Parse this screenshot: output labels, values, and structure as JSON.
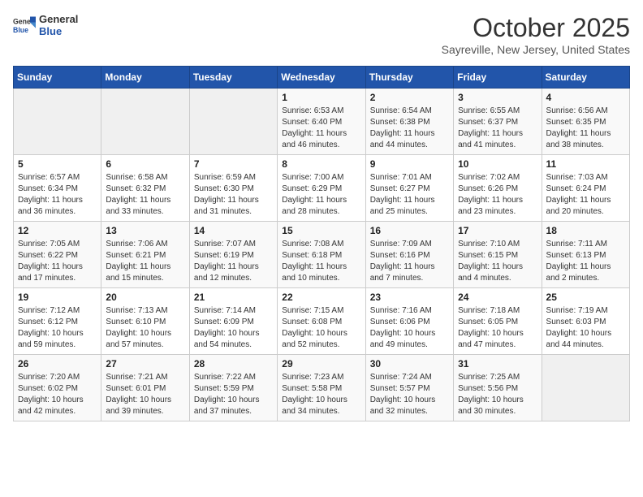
{
  "header": {
    "logo_general": "General",
    "logo_blue": "Blue",
    "title": "October 2025",
    "subtitle": "Sayreville, New Jersey, United States"
  },
  "days_of_week": [
    "Sunday",
    "Monday",
    "Tuesday",
    "Wednesday",
    "Thursday",
    "Friday",
    "Saturday"
  ],
  "weeks": [
    [
      {
        "day": "",
        "sunrise": "",
        "sunset": "",
        "daylight": "",
        "empty": true
      },
      {
        "day": "",
        "sunrise": "",
        "sunset": "",
        "daylight": "",
        "empty": true
      },
      {
        "day": "",
        "sunrise": "",
        "sunset": "",
        "daylight": "",
        "empty": true
      },
      {
        "day": "1",
        "sunrise": "Sunrise: 6:53 AM",
        "sunset": "Sunset: 6:40 PM",
        "daylight": "Daylight: 11 hours and 46 minutes."
      },
      {
        "day": "2",
        "sunrise": "Sunrise: 6:54 AM",
        "sunset": "Sunset: 6:38 PM",
        "daylight": "Daylight: 11 hours and 44 minutes."
      },
      {
        "day": "3",
        "sunrise": "Sunrise: 6:55 AM",
        "sunset": "Sunset: 6:37 PM",
        "daylight": "Daylight: 11 hours and 41 minutes."
      },
      {
        "day": "4",
        "sunrise": "Sunrise: 6:56 AM",
        "sunset": "Sunset: 6:35 PM",
        "daylight": "Daylight: 11 hours and 38 minutes."
      }
    ],
    [
      {
        "day": "5",
        "sunrise": "Sunrise: 6:57 AM",
        "sunset": "Sunset: 6:34 PM",
        "daylight": "Daylight: 11 hours and 36 minutes."
      },
      {
        "day": "6",
        "sunrise": "Sunrise: 6:58 AM",
        "sunset": "Sunset: 6:32 PM",
        "daylight": "Daylight: 11 hours and 33 minutes."
      },
      {
        "day": "7",
        "sunrise": "Sunrise: 6:59 AM",
        "sunset": "Sunset: 6:30 PM",
        "daylight": "Daylight: 11 hours and 31 minutes."
      },
      {
        "day": "8",
        "sunrise": "Sunrise: 7:00 AM",
        "sunset": "Sunset: 6:29 PM",
        "daylight": "Daylight: 11 hours and 28 minutes."
      },
      {
        "day": "9",
        "sunrise": "Sunrise: 7:01 AM",
        "sunset": "Sunset: 6:27 PM",
        "daylight": "Daylight: 11 hours and 25 minutes."
      },
      {
        "day": "10",
        "sunrise": "Sunrise: 7:02 AM",
        "sunset": "Sunset: 6:26 PM",
        "daylight": "Daylight: 11 hours and 23 minutes."
      },
      {
        "day": "11",
        "sunrise": "Sunrise: 7:03 AM",
        "sunset": "Sunset: 6:24 PM",
        "daylight": "Daylight: 11 hours and 20 minutes."
      }
    ],
    [
      {
        "day": "12",
        "sunrise": "Sunrise: 7:05 AM",
        "sunset": "Sunset: 6:22 PM",
        "daylight": "Daylight: 11 hours and 17 minutes."
      },
      {
        "day": "13",
        "sunrise": "Sunrise: 7:06 AM",
        "sunset": "Sunset: 6:21 PM",
        "daylight": "Daylight: 11 hours and 15 minutes."
      },
      {
        "day": "14",
        "sunrise": "Sunrise: 7:07 AM",
        "sunset": "Sunset: 6:19 PM",
        "daylight": "Daylight: 11 hours and 12 minutes."
      },
      {
        "day": "15",
        "sunrise": "Sunrise: 7:08 AM",
        "sunset": "Sunset: 6:18 PM",
        "daylight": "Daylight: 11 hours and 10 minutes."
      },
      {
        "day": "16",
        "sunrise": "Sunrise: 7:09 AM",
        "sunset": "Sunset: 6:16 PM",
        "daylight": "Daylight: 11 hours and 7 minutes."
      },
      {
        "day": "17",
        "sunrise": "Sunrise: 7:10 AM",
        "sunset": "Sunset: 6:15 PM",
        "daylight": "Daylight: 11 hours and 4 minutes."
      },
      {
        "day": "18",
        "sunrise": "Sunrise: 7:11 AM",
        "sunset": "Sunset: 6:13 PM",
        "daylight": "Daylight: 11 hours and 2 minutes."
      }
    ],
    [
      {
        "day": "19",
        "sunrise": "Sunrise: 7:12 AM",
        "sunset": "Sunset: 6:12 PM",
        "daylight": "Daylight: 10 hours and 59 minutes."
      },
      {
        "day": "20",
        "sunrise": "Sunrise: 7:13 AM",
        "sunset": "Sunset: 6:10 PM",
        "daylight": "Daylight: 10 hours and 57 minutes."
      },
      {
        "day": "21",
        "sunrise": "Sunrise: 7:14 AM",
        "sunset": "Sunset: 6:09 PM",
        "daylight": "Daylight: 10 hours and 54 minutes."
      },
      {
        "day": "22",
        "sunrise": "Sunrise: 7:15 AM",
        "sunset": "Sunset: 6:08 PM",
        "daylight": "Daylight: 10 hours and 52 minutes."
      },
      {
        "day": "23",
        "sunrise": "Sunrise: 7:16 AM",
        "sunset": "Sunset: 6:06 PM",
        "daylight": "Daylight: 10 hours and 49 minutes."
      },
      {
        "day": "24",
        "sunrise": "Sunrise: 7:18 AM",
        "sunset": "Sunset: 6:05 PM",
        "daylight": "Daylight: 10 hours and 47 minutes."
      },
      {
        "day": "25",
        "sunrise": "Sunrise: 7:19 AM",
        "sunset": "Sunset: 6:03 PM",
        "daylight": "Daylight: 10 hours and 44 minutes."
      }
    ],
    [
      {
        "day": "26",
        "sunrise": "Sunrise: 7:20 AM",
        "sunset": "Sunset: 6:02 PM",
        "daylight": "Daylight: 10 hours and 42 minutes."
      },
      {
        "day": "27",
        "sunrise": "Sunrise: 7:21 AM",
        "sunset": "Sunset: 6:01 PM",
        "daylight": "Daylight: 10 hours and 39 minutes."
      },
      {
        "day": "28",
        "sunrise": "Sunrise: 7:22 AM",
        "sunset": "Sunset: 5:59 PM",
        "daylight": "Daylight: 10 hours and 37 minutes."
      },
      {
        "day": "29",
        "sunrise": "Sunrise: 7:23 AM",
        "sunset": "Sunset: 5:58 PM",
        "daylight": "Daylight: 10 hours and 34 minutes."
      },
      {
        "day": "30",
        "sunrise": "Sunrise: 7:24 AM",
        "sunset": "Sunset: 5:57 PM",
        "daylight": "Daylight: 10 hours and 32 minutes."
      },
      {
        "day": "31",
        "sunrise": "Sunrise: 7:25 AM",
        "sunset": "Sunset: 5:56 PM",
        "daylight": "Daylight: 10 hours and 30 minutes."
      },
      {
        "day": "",
        "sunrise": "",
        "sunset": "",
        "daylight": "",
        "empty": true
      }
    ]
  ]
}
